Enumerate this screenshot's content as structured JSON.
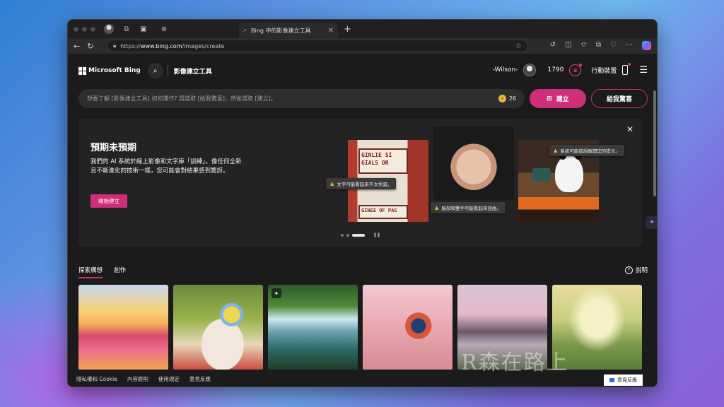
{
  "browser": {
    "tab_title": "Bing 中的影像建立工具",
    "url_prefix": "https://",
    "url_host": "www.bing.com",
    "url_path": "/images/create"
  },
  "header": {
    "brand": "Microsoft Bing",
    "product": "影像建立工具",
    "username": "-Wilson-",
    "points": "1790",
    "mobile_label": "行動裝置"
  },
  "prompt": {
    "placeholder": "想要了解 [影像建立工具] 如何運作? 請選取 [給我驚喜]，然後選取 [建立]。",
    "boosts": "26",
    "create_label": "建立",
    "surprise_label": "給我驚喜"
  },
  "hero": {
    "title": "預期未預期",
    "description": "我們的 AI 系統於線上影像和文字庫「訓練」。像任何全新且不斷進化的技術一樣，您可能會對結果感到驚訝。",
    "start_label": "開始建立",
    "tooltips": [
      "文字可能看起來不太恰當。",
      "臉部和雙手可能看起來扭曲。",
      "系統可能錯誤解讀您的提示。"
    ],
    "gas_sign_text": "GINLIE SI GIALS OR",
    "gas_sign_text2": "GINEE OF PAS",
    "carousel_count": 3,
    "carousel_active": 3
  },
  "tabs": {
    "explore": "探索構想",
    "creations": "創作",
    "help": "說明"
  },
  "gallery": [
    "tulips",
    "picnic",
    "waterfall",
    "butterfly",
    "cherry-path",
    "kite"
  ],
  "footer": {
    "privacy": "隱私權和 Cookie",
    "content_policy": "內容原則",
    "terms": "使用規定",
    "feedback": "意見反應",
    "feedback_button": "意見反應"
  },
  "watermark": "R森在路上",
  "colors": {
    "accent": "#cf2e7a",
    "background": "#1b1b1b"
  }
}
